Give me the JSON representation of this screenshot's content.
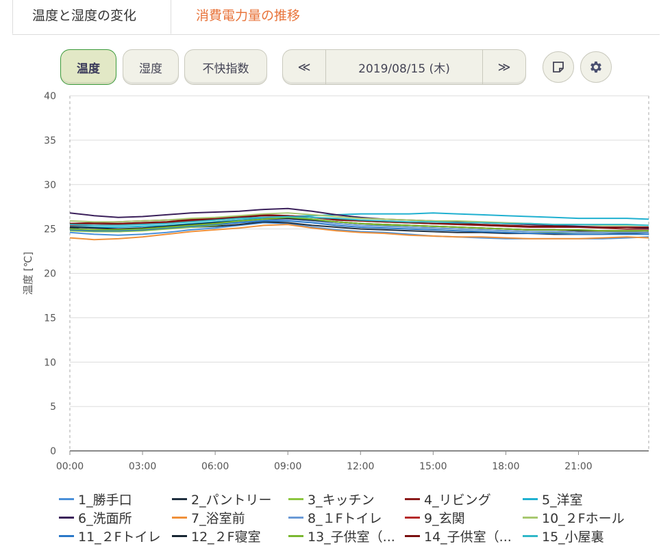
{
  "tabs": [
    {
      "label": "温度と湿度の変化",
      "active": true
    },
    {
      "label": "消費電力量の推移",
      "active": false
    }
  ],
  "controls": {
    "temp_label": "温度",
    "humidity_label": "湿度",
    "discomfort_label": "不快指数",
    "prev": "≪",
    "date": "2019/08/15 (木)",
    "next": "≫"
  },
  "colors": {
    "accent": "#3a9a3a",
    "tab_other": "#e8743b"
  },
  "chart_data": {
    "type": "line",
    "title": "",
    "xlabel": "",
    "ylabel": "温度 [℃]",
    "ylim": [
      0,
      40
    ],
    "yticks": [
      0,
      5,
      10,
      15,
      20,
      25,
      30,
      35,
      40
    ],
    "xlim": [
      0,
      23.9
    ],
    "xticks": [
      "00:00",
      "03:00",
      "06:00",
      "09:00",
      "12:00",
      "15:00",
      "18:00",
      "21:00"
    ],
    "x_hours": [
      0,
      1,
      2,
      3,
      4,
      5,
      6,
      7,
      8,
      9,
      10,
      11,
      12,
      13,
      14,
      15,
      16,
      17,
      18,
      19,
      20,
      21,
      22,
      23,
      23.9
    ],
    "series": [
      {
        "name": "1_勝手口",
        "color": "#4a90d9",
        "values": [
          24.6,
          24.4,
          24.3,
          24.4,
          24.6,
          24.9,
          25.1,
          25.4,
          25.7,
          25.6,
          25.2,
          24.9,
          24.7,
          24.6,
          24.4,
          24.2,
          24.1,
          24.0,
          23.9,
          23.9,
          23.9,
          23.9,
          23.9,
          24.0,
          24.1
        ]
      },
      {
        "name": "2_パントリー",
        "color": "#1f2f3f",
        "values": [
          25.1,
          24.8,
          24.7,
          24.9,
          25.1,
          25.2,
          25.3,
          25.5,
          25.8,
          25.7,
          25.4,
          25.2,
          25.0,
          24.9,
          24.8,
          24.7,
          24.6,
          24.6,
          24.5,
          24.5,
          24.4,
          24.4,
          24.4,
          24.5,
          24.6
        ]
      },
      {
        "name": "3_キッチン",
        "color": "#8cc63f",
        "values": [
          24.8,
          24.7,
          24.7,
          24.8,
          25.0,
          25.2,
          25.4,
          25.8,
          26.2,
          26.4,
          26.1,
          25.8,
          25.6,
          25.4,
          25.2,
          25.1,
          25.0,
          24.9,
          24.8,
          24.7,
          24.6,
          24.6,
          24.6,
          24.7,
          24.8
        ]
      },
      {
        "name": "4_リビング",
        "color": "#8b1a1a",
        "values": [
          25.6,
          25.7,
          25.8,
          25.9,
          26.0,
          26.1,
          26.2,
          26.4,
          26.6,
          26.5,
          26.3,
          26.0,
          25.9,
          25.8,
          25.7,
          25.6,
          25.5,
          25.4,
          25.3,
          25.2,
          25.2,
          25.2,
          25.1,
          25.0,
          25.0
        ]
      },
      {
        "name": "5_洋室",
        "color": "#1fb0d0",
        "values": [
          25.3,
          25.2,
          25.2,
          25.3,
          25.4,
          25.6,
          25.8,
          26.0,
          26.2,
          26.4,
          26.5,
          26.6,
          26.7,
          26.7,
          26.7,
          26.8,
          26.7,
          26.6,
          26.5,
          26.4,
          26.3,
          26.2,
          26.2,
          26.2,
          26.1
        ]
      },
      {
        "name": "6_洗面所",
        "color": "#3a1f5a",
        "values": [
          26.8,
          26.5,
          26.3,
          26.4,
          26.6,
          26.8,
          26.9,
          27.0,
          27.2,
          27.3,
          27.0,
          26.6,
          26.3,
          26.1,
          26.0,
          25.9,
          25.8,
          25.7,
          25.6,
          25.5,
          25.4,
          25.3,
          25.2,
          25.2,
          25.1
        ]
      },
      {
        "name": "7_浴室前",
        "color": "#f0913a",
        "values": [
          24.0,
          23.8,
          23.9,
          24.1,
          24.4,
          24.7,
          24.9,
          25.1,
          25.4,
          25.5,
          25.1,
          24.8,
          24.6,
          24.5,
          24.3,
          24.2,
          24.1,
          24.1,
          24.0,
          23.9,
          23.9,
          23.9,
          24.0,
          24.1,
          24.0
        ]
      },
      {
        "name": "8_１Fトイレ",
        "color": "#6a9ad6",
        "values": [
          25.0,
          24.9,
          24.9,
          25.0,
          25.2,
          25.4,
          25.6,
          25.8,
          26.0,
          26.1,
          25.9,
          25.6,
          25.4,
          25.3,
          25.2,
          25.1,
          25.0,
          24.9,
          24.8,
          24.7,
          24.7,
          24.6,
          24.6,
          24.6,
          24.6
        ]
      },
      {
        "name": "9_玄関",
        "color": "#b52a2a",
        "values": [
          25.4,
          25.4,
          25.5,
          25.6,
          25.7,
          25.9,
          26.0,
          26.2,
          26.3,
          26.2,
          26.0,
          25.8,
          25.6,
          25.5,
          25.4,
          25.3,
          25.2,
          25.1,
          25.0,
          24.9,
          24.9,
          24.8,
          24.8,
          24.8,
          24.8
        ]
      },
      {
        "name": "10_２Fホール",
        "color": "#a8c870",
        "values": [
          25.9,
          25.8,
          25.8,
          25.9,
          26.0,
          26.2,
          26.3,
          26.5,
          26.7,
          26.8,
          26.6,
          26.4,
          26.2,
          26.1,
          26.0,
          25.9,
          25.9,
          25.8,
          25.7,
          25.6,
          25.5,
          25.5,
          25.4,
          25.4,
          25.4
        ]
      },
      {
        "name": "11_２Fトイレ",
        "color": "#2a78c8",
        "values": [
          24.9,
          24.8,
          24.8,
          24.9,
          25.1,
          25.3,
          25.5,
          25.7,
          25.9,
          25.9,
          25.7,
          25.4,
          25.2,
          25.1,
          25.0,
          24.9,
          24.8,
          24.7,
          24.6,
          24.5,
          24.5,
          24.4,
          24.4,
          24.4,
          24.4
        ]
      },
      {
        "name": "12_２F寝室",
        "color": "#172633",
        "values": [
          25.2,
          25.1,
          25.0,
          25.1,
          25.3,
          25.5,
          25.7,
          25.9,
          26.1,
          26.2,
          26.0,
          25.8,
          25.6,
          25.5,
          25.4,
          25.3,
          25.2,
          25.1,
          25.0,
          24.9,
          24.9,
          24.8,
          24.8,
          24.8,
          24.8
        ]
      },
      {
        "name": "13_子供室（...",
        "color": "#7ab830",
        "values": [
          25.0,
          24.9,
          24.9,
          25.0,
          25.2,
          25.4,
          25.6,
          25.9,
          26.1,
          26.3,
          26.1,
          25.8,
          25.6,
          25.5,
          25.4,
          25.3,
          25.2,
          25.1,
          25.0,
          24.9,
          24.9,
          24.9,
          24.8,
          24.8,
          24.8
        ]
      },
      {
        "name": "14_子供室（...",
        "color": "#7a1010",
        "values": [
          25.6,
          25.6,
          25.6,
          25.7,
          25.8,
          26.0,
          26.1,
          26.3,
          26.5,
          26.5,
          26.3,
          26.1,
          25.9,
          25.8,
          25.7,
          25.6,
          25.6,
          25.5,
          25.4,
          25.3,
          25.3,
          25.2,
          25.2,
          25.2,
          25.2
        ]
      },
      {
        "name": "15_小屋裏",
        "color": "#30b8c8",
        "values": [
          25.5,
          25.4,
          25.4,
          25.5,
          25.6,
          25.8,
          26.0,
          26.2,
          26.3,
          26.4,
          26.3,
          26.2,
          26.0,
          25.9,
          25.8,
          25.8,
          25.7,
          25.7,
          25.6,
          25.6,
          25.5,
          25.5,
          25.5,
          25.5,
          25.4
        ]
      }
    ]
  }
}
